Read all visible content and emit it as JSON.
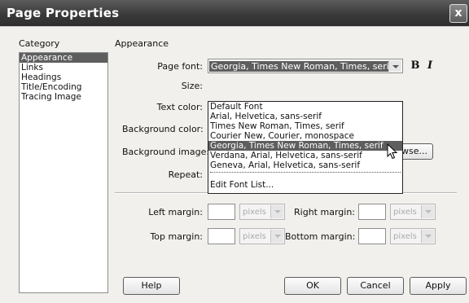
{
  "window": {
    "title": "Page Properties",
    "close_label": "x"
  },
  "category": {
    "heading": "Category",
    "items": [
      "Appearance",
      "Links",
      "Headings",
      "Title/Encoding",
      "Tracing Image"
    ],
    "selected_index": 0
  },
  "appearance": {
    "heading": "Appearance",
    "page_font_label": "Page font:",
    "page_font_value": "Georgia, Times New Roman, Times, serif",
    "bold_label": "B",
    "italic_label": "I",
    "size_label": "Size:",
    "text_color_label": "Text color:",
    "background_color_label": "Background color:",
    "background_image_label": "Background image:",
    "browse_label": "wse...",
    "repeat_label": "Repeat:",
    "left_margin_label": "Left margin:",
    "right_margin_label": "Right margin:",
    "top_margin_label": "Top margin:",
    "bottom_margin_label": "Bottom margin:",
    "units_placeholder": "pixels"
  },
  "font_dropdown": {
    "options": [
      "Default Font",
      "Arial, Helvetica, sans-serif",
      "Times New Roman, Times, serif",
      "Courier New, Courier, monospace",
      "Georgia, Times New Roman, Times, serif",
      "Verdana, Arial, Helvetica, sans-serif",
      "Geneva, Arial, Helvetica, sans-serif"
    ],
    "highlighted_index": 4,
    "edit_label": "Edit Font List..."
  },
  "buttons": {
    "help": "Help",
    "ok": "OK",
    "cancel": "Cancel",
    "apply": "Apply"
  },
  "icons": {
    "close": "close-icon",
    "cursor": "mouse-pointer-icon",
    "dropdown": "chevron-down-icon"
  }
}
